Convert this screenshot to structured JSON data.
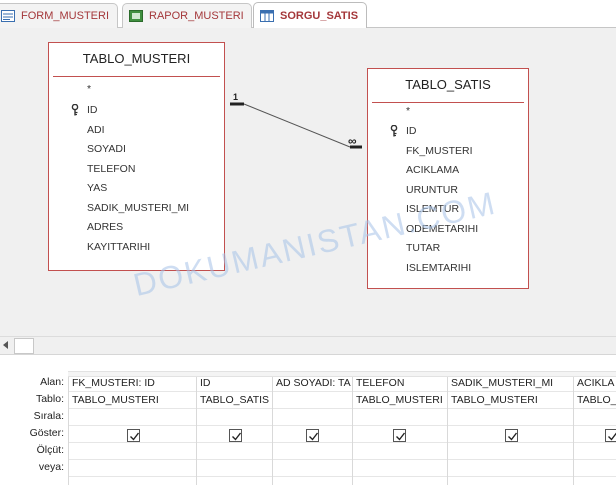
{
  "tabs": [
    {
      "label": "FORM_MUSTERI",
      "icon": "form-icon"
    },
    {
      "label": "RAPOR_MUSTERI",
      "icon": "report-icon"
    },
    {
      "label": "SORGU_SATIS",
      "icon": "query-icon",
      "active": true
    }
  ],
  "tables": [
    {
      "name": "TABLO_MUSTERI",
      "fields": [
        "*",
        "ID",
        "ADI",
        "SOYADI",
        "TELEFON",
        "YAS",
        "SADIK_MUSTERI_MI",
        "ADRES",
        "KAYITTARIHI"
      ],
      "key_field": "ID"
    },
    {
      "name": "TABLO_SATIS",
      "fields": [
        "*",
        "ID",
        "FK_MUSTERI",
        "ACIKLAMA",
        "URUNTUR",
        "ISLEMTUR",
        "ODEMETARIHI",
        "TUTAR",
        "ISLEMTARIHI"
      ],
      "key_field": "ID"
    }
  ],
  "relationship": {
    "from": "TABLO_MUSTERI.ID",
    "to": "TABLO_SATIS.FK_MUSTERI",
    "from_card": "1",
    "to_card": "∞"
  },
  "watermark": "DOKUMANISTAN.COM",
  "grid": {
    "row_labels": [
      "Alan:",
      "Tablo:",
      "Sırala:",
      "Göster:",
      "Ölçüt:",
      "veya:"
    ],
    "columns": [
      {
        "field": "FK_MUSTERI: ID",
        "table": "TABLO_MUSTERI",
        "show": true
      },
      {
        "field": "ID",
        "table": "TABLO_SATIS",
        "show": true
      },
      {
        "field": "AD SOYADI: TA",
        "table": "",
        "show": true
      },
      {
        "field": "TELEFON",
        "table": "TABLO_MUSTERI",
        "show": true
      },
      {
        "field": "SADIK_MUSTERI_MI",
        "table": "TABLO_MUSTERI",
        "show": true
      },
      {
        "field": "ACIKLA",
        "table": "TABLO_",
        "show": true
      }
    ]
  },
  "colors": {
    "accent": "#a4373a",
    "table_border": "#c2504f",
    "watermark": "#a7c3e8"
  }
}
